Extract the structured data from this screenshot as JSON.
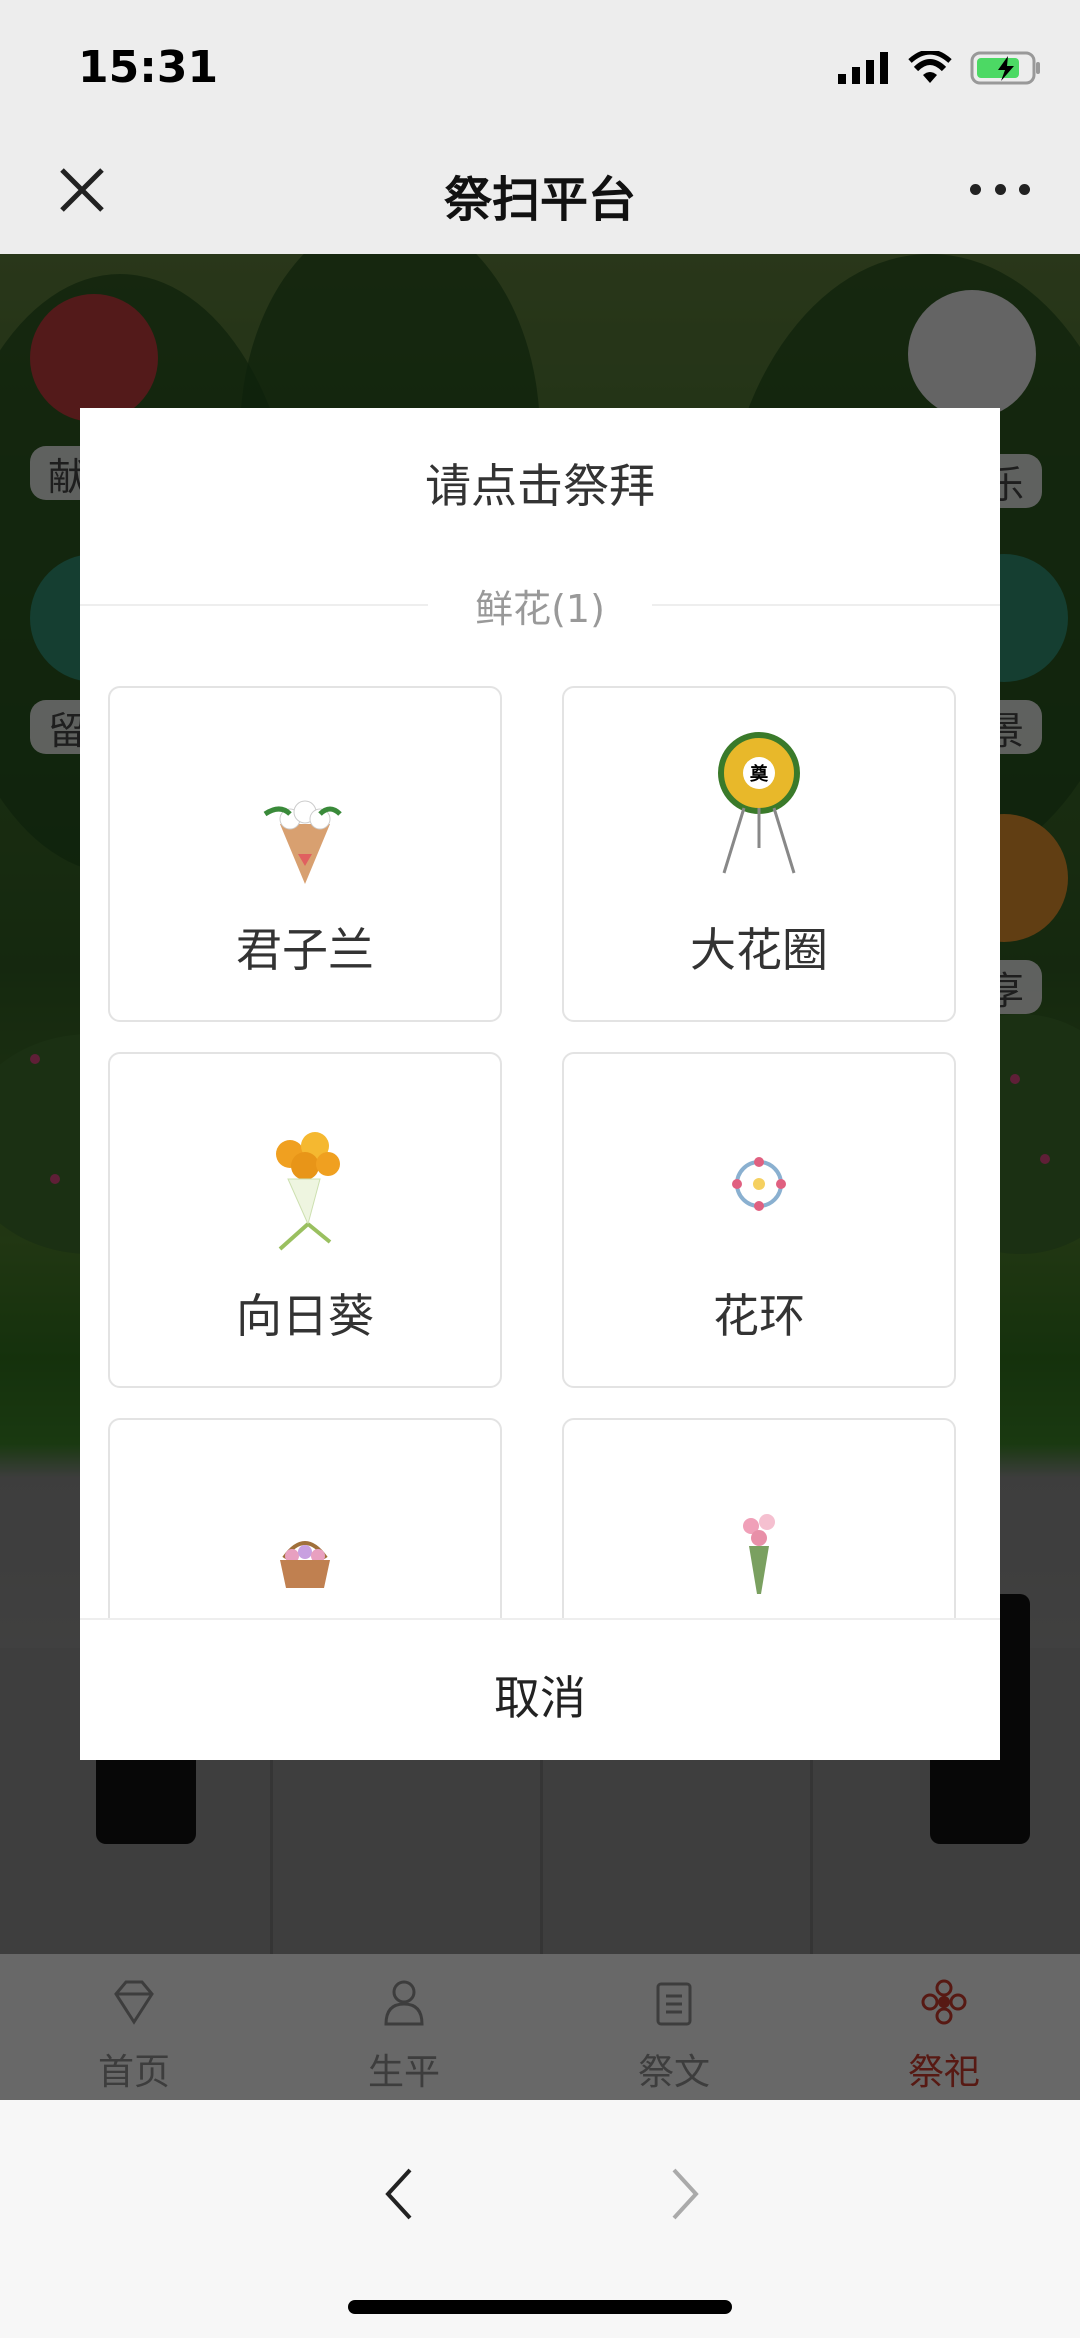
{
  "status_bar": {
    "time": "15:31"
  },
  "nav": {
    "title": "祭扫平台"
  },
  "background_buttons": {
    "left": [
      "献",
      "留"
    ],
    "right": [
      "乐",
      "景",
      "享"
    ]
  },
  "tabbar": {
    "tabs": [
      {
        "label": "首页",
        "icon": "diamond-icon"
      },
      {
        "label": "生平",
        "icon": "person-icon"
      },
      {
        "label": "祭文",
        "icon": "clipboard-icon"
      },
      {
        "label": "祭祀",
        "icon": "flower-icon",
        "active": true
      }
    ]
  },
  "modal": {
    "title": "请点击祭拜",
    "section": "鲜花(1)",
    "items": [
      {
        "label": "君子兰",
        "icon": "bouquet-icon"
      },
      {
        "label": "大花圈",
        "icon": "funeral-wreath-icon"
      },
      {
        "label": "向日葵",
        "icon": "sunflower-bouquet-icon"
      },
      {
        "label": "花环",
        "icon": "garland-icon"
      },
      {
        "label": "",
        "icon": "flower-basket-icon"
      },
      {
        "label": "",
        "icon": "pink-bouquet-icon"
      }
    ],
    "cancel": "取消"
  },
  "colors": {
    "active_tab": "#c0392b",
    "overlay": "rgba(0,0,0,0.55)"
  }
}
